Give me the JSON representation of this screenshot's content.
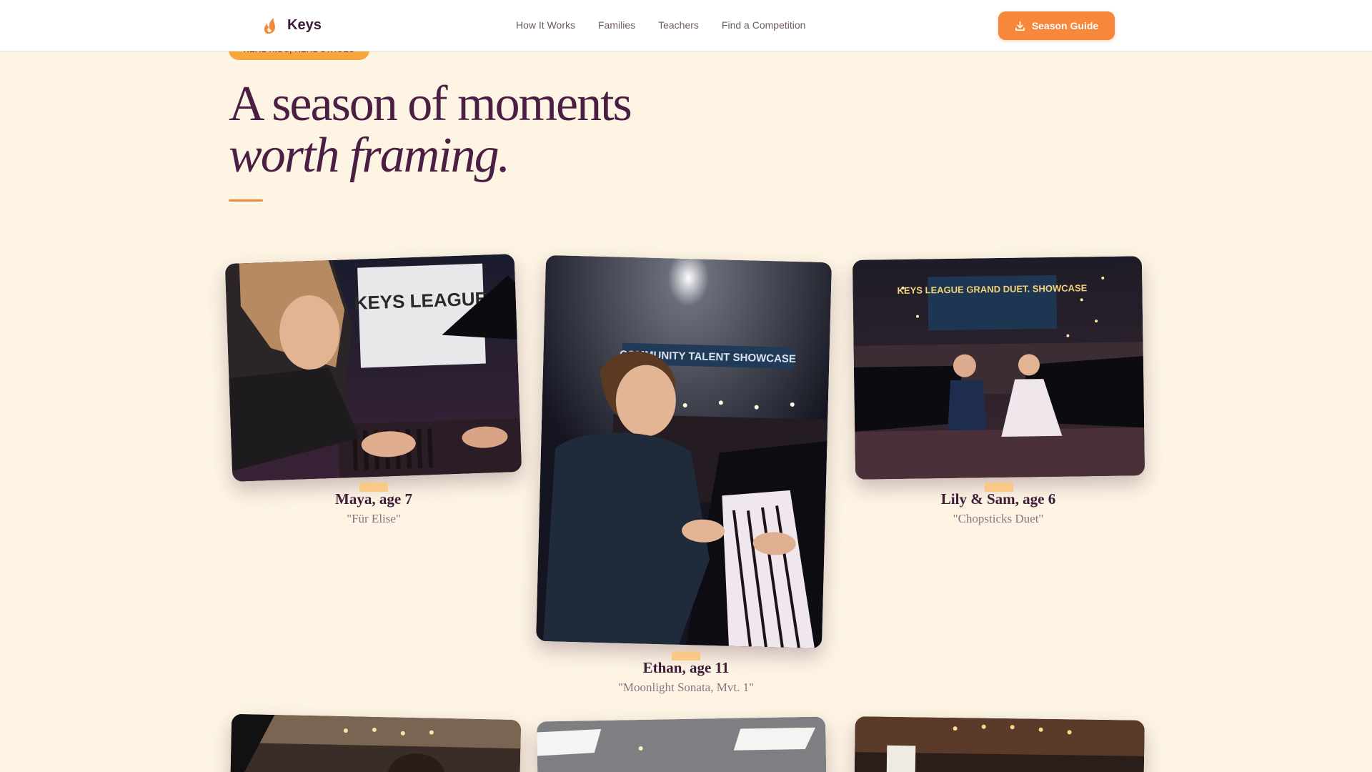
{
  "header": {
    "brand": "Keys",
    "nav": [
      "How It Works",
      "Families",
      "Teachers",
      "Find a Competition"
    ],
    "cta_label": "Season Guide"
  },
  "hero": {
    "eyebrow": "REAL KIDS, REAL STAGES",
    "title_line1": "A season of moments",
    "title_line2": "worth framing."
  },
  "gallery": [
    {
      "name": "Maya, age 7",
      "piece": "\"Für Elise\"",
      "photo_banner": "KEYS LEAGUE"
    },
    {
      "name": "Ethan, age 11",
      "piece": "\"Moonlight Sonata, Mvt. 1\"",
      "photo_banner": "COMMUNITY TALENT SHOWCASE"
    },
    {
      "name": "Lily & Sam, age 6",
      "piece": "\"Chopsticks Duet\"",
      "photo_banner": "KEYS LEAGUE GRAND DUET. SHOWCASE"
    }
  ],
  "colors": {
    "background": "#fdf4e3",
    "accent": "#f7873b",
    "pill": "#f5a63d",
    "heading": "#4a1f43"
  },
  "icons": {
    "brand": "flame-logo-icon",
    "cta": "download-icon"
  }
}
